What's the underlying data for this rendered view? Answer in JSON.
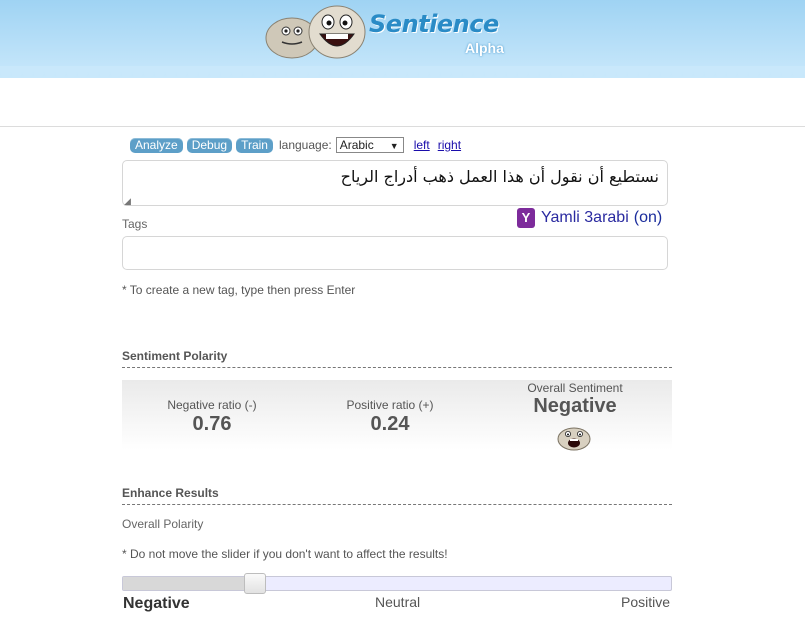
{
  "header": {
    "app_name": "Sentience",
    "version": "Alpha",
    "logo_icon": "two-rock-faces-logo"
  },
  "toolbar": {
    "tabs": [
      "Analyze",
      "Debug",
      "Train"
    ],
    "language_label": "language:",
    "language_selected": "Arabic",
    "link_left": "left",
    "link_right": "right"
  },
  "input": {
    "text": "نستطيع أن نقول أن هذا العمل ذهب أدراج الرياح"
  },
  "yamli": {
    "badge": "Y",
    "label": "Yamli 3arabi",
    "status_open": "(",
    "status": "on",
    "status_close": ")"
  },
  "tags": {
    "label": "Tags",
    "value": "",
    "hint": "* To create a new tag, type then press Enter"
  },
  "sentiment": {
    "title": "Sentiment Polarity",
    "negative_label": "Negative ratio (-)",
    "negative_value": "0.76",
    "positive_label": "Positive ratio (+)",
    "positive_value": "0.24",
    "overall_label": "Overall Sentiment",
    "overall_value": "Negative",
    "overall_icon": "sad-rock-face-icon"
  },
  "enhance": {
    "title": "Enhance Results",
    "polarity_label": "Overall Polarity",
    "slider_hint": "* Do not move the slider if you don't want to affect the results!",
    "slider_position": 0.24,
    "scale_negative": "Negative",
    "scale_neutral": "Neutral",
    "scale_positive": "Positive"
  },
  "colors": {
    "header_bg": "#b3def8",
    "tab_bg": "#5d9fc8",
    "link": "#1a0dab",
    "yamli_badge": "#7d2b9b"
  }
}
